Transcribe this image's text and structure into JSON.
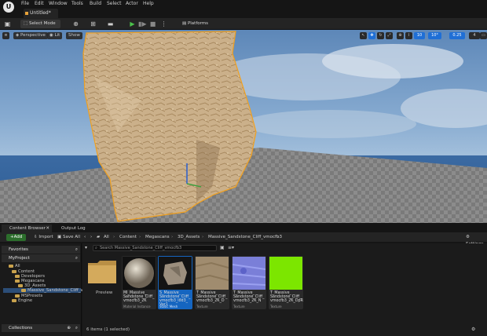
{
  "menu": {
    "logo": "U",
    "items": [
      "File",
      "Edit",
      "Window",
      "Tools",
      "Build",
      "Select",
      "Actor",
      "Help"
    ]
  },
  "document_tab": "Untitled*",
  "toolbar": {
    "select_mode": "Select Mode",
    "platforms": "Platforms"
  },
  "viewport": {
    "perspective": "Perspective",
    "lit": "Lit",
    "show": "Show",
    "grid_snap": "10",
    "rotation_snap": "10°",
    "scale_snap": "0.25",
    "camera_speed": "4"
  },
  "panel_tabs": {
    "content_browser": "Content Browser",
    "output_log": "Output Log"
  },
  "content_browser": {
    "add": "Add",
    "import": "Import",
    "save_all": "Save All",
    "breadcrumbs": [
      "All",
      "Content",
      "Megascans",
      "3D_Assets",
      "Massive_Sandstone_Cliff_vmocfb3"
    ],
    "settings": "Settings",
    "search_placeholder": "Search Massive_Sandstone_Cliff_vmocfb3",
    "items_count": "6 items (1 selected)",
    "preview_label": "Preview"
  },
  "sources": {
    "favorites": "Favorites",
    "project": "MyProject",
    "collections": "Collections",
    "tree": [
      "All",
      "Content",
      "Developers",
      "Megascans",
      "3D_Assets",
      "Massive_Sandstone_Cliff_vm",
      "MSPresets",
      "Engine"
    ]
  },
  "assets": [
    {
      "name": "MI_Massive_\nSandstone_Cliff_\nvmocfb3_2K",
      "type": "Material Instance"
    },
    {
      "name": "S_Massive_\nSandstone_Cliff_\nvmocfb3_lod3_\nVar1",
      "type": "Static Mesh"
    },
    {
      "name": "T_Massive_\nSandstone_Cliff_\nvmocfb3_2K_D",
      "type": "Texture"
    },
    {
      "name": "T_Massive_\nSandstone_Cliff_\nvmocfb3_2K_N",
      "type": "Texture"
    },
    {
      "name": "T_Massive_\nSandstone_Cliff_\nvmocfb3_2K_DpR",
      "type": "Texture"
    }
  ],
  "colors": {
    "accent": "#1f6fd6",
    "selected": "#1565c0",
    "add_button": "#2c6e2c",
    "folder": "#c9a24d"
  }
}
